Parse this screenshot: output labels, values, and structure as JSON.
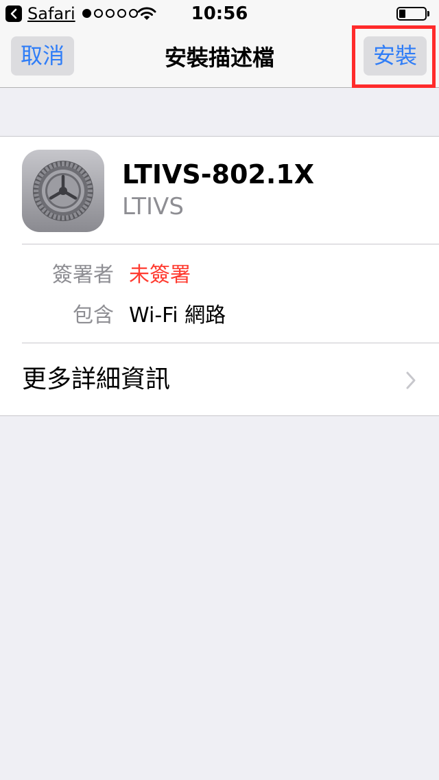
{
  "status_bar": {
    "back_app": "Safari",
    "time": "10:56",
    "signal_filled": 1,
    "signal_total": 5,
    "battery_level": 0.25
  },
  "nav": {
    "cancel_label": "取消",
    "title": "安裝描述檔",
    "install_label": "安裝"
  },
  "profile": {
    "name": "LTIVS-802.1X",
    "organization": "LTIVS",
    "icon": "settings-gear-icon"
  },
  "details": [
    {
      "label": "簽署者",
      "value": "未簽署"
    },
    {
      "label": "包含",
      "value": "Wi-Fi 網路"
    }
  ],
  "more_details_label": "更多詳細資訊",
  "colors": {
    "accent": "#2f7df7",
    "unsigned": "#ff3b30",
    "highlight": "#ff2b2b",
    "background": "#efeff4"
  }
}
